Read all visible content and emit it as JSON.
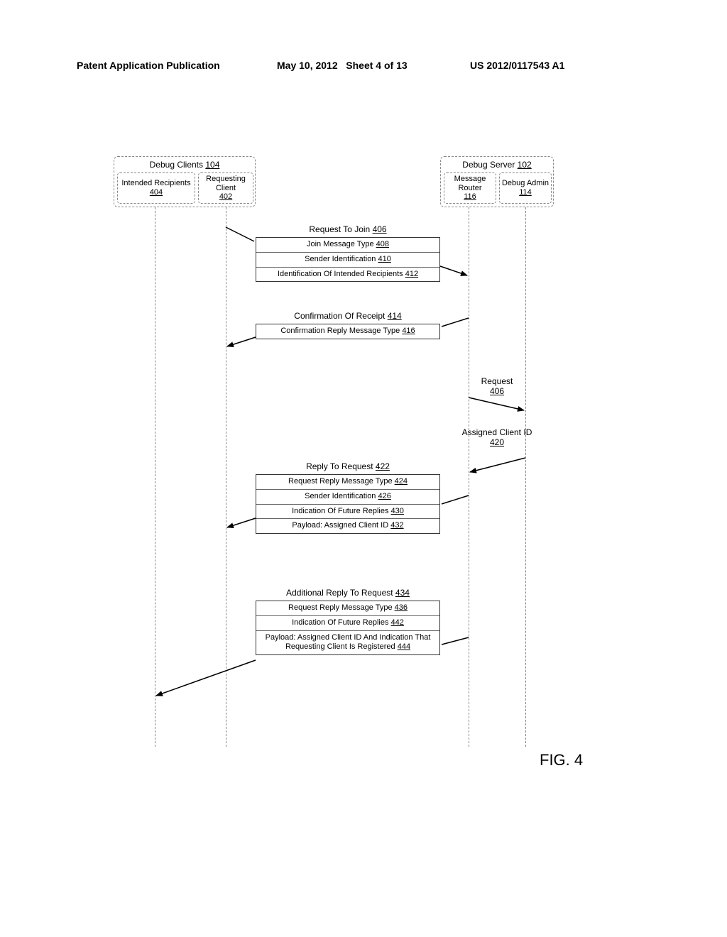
{
  "header": {
    "left": "Patent Application Publication",
    "mid_date": "May 10, 2012",
    "mid_sheet": "Sheet 4 of 13",
    "right": "US 2012/0117543 A1"
  },
  "lanes": {
    "clients_title": "Debug Clients",
    "clients_title_ref": "104",
    "intended_label": "Intended Recipients",
    "intended_ref": "404",
    "requesting_label": "Requesting Client",
    "requesting_ref": "402",
    "server_title": "Debug Server",
    "server_title_ref": "102",
    "router_label": "Message Router",
    "router_ref": "116",
    "admin_label": "Debug Admin",
    "admin_ref": "114"
  },
  "msg1": {
    "title": "Request To Join",
    "title_ref": "406",
    "r1": "Join Message Type",
    "r1_ref": "408",
    "r2": "Sender Identification",
    "r2_ref": "410",
    "r3": "Identification Of Intended Recipients",
    "r3_ref": "412"
  },
  "msg2": {
    "title": "Confirmation Of Receipt",
    "title_ref": "414",
    "r1": "Confirmation Reply Message Type",
    "r1_ref": "416"
  },
  "internal": {
    "req_label": "Request",
    "req_ref": "406",
    "assigned_label": "Assigned Client ID",
    "assigned_ref": "420"
  },
  "msg3": {
    "title": "Reply To Request",
    "title_ref": "422",
    "r1": "Request Reply Message Type",
    "r1_ref": "424",
    "r2": "Sender Identification",
    "r2_ref": "426",
    "r3": "Indication Of Future Replies",
    "r3_ref": "430",
    "r4": "Payload: Assigned Client ID",
    "r4_ref": "432"
  },
  "msg4": {
    "title": "Additional Reply To Request",
    "title_ref": "434",
    "r1": "Request Reply Message Type",
    "r1_ref": "436",
    "r2": "Indication Of Future Replies",
    "r2_ref": "442",
    "r3": "Payload: Assigned Client ID  And Indication That Requesting Client Is Registered",
    "r3_ref": "444"
  },
  "figure_label": "FIG. 4",
  "chart_data": {
    "type": "table",
    "description": "UML-style sequence diagram of message exchange between Debug Clients and Debug Server",
    "lifelines": [
      "Intended Recipients 404",
      "Requesting Client 402",
      "Message Router 116",
      "Debug Admin 114"
    ],
    "messages": [
      {
        "from": "Requesting Client 402",
        "to": "Message Router 116",
        "label": "Request To Join 406",
        "fields": [
          "Join Message Type 408",
          "Sender Identification 410",
          "Identification Of Intended Recipients 412"
        ]
      },
      {
        "from": "Message Router 116",
        "to": "Requesting Client 402",
        "label": "Confirmation Of Receipt 414",
        "fields": [
          "Confirmation Reply Message Type 416"
        ]
      },
      {
        "from": "Message Router 116",
        "to": "Debug Admin 114",
        "label": "Request 406"
      },
      {
        "from": "Debug Admin 114",
        "to": "Message Router 116",
        "label": "Assigned Client ID 420"
      },
      {
        "from": "Message Router 116",
        "to": "Requesting Client 402",
        "label": "Reply To Request 422",
        "fields": [
          "Request Reply Message Type 424",
          "Sender Identification 426",
          "Indication Of Future Replies 430",
          "Payload: Assigned Client ID 432"
        ]
      },
      {
        "from": "Message Router 116",
        "to": "Intended Recipients 404",
        "label": "Additional Reply To Request 434",
        "fields": [
          "Request Reply Message Type 436",
          "Indication Of Future Replies 442",
          "Payload: Assigned Client ID And Indication That Requesting Client Is Registered 444"
        ]
      }
    ]
  }
}
